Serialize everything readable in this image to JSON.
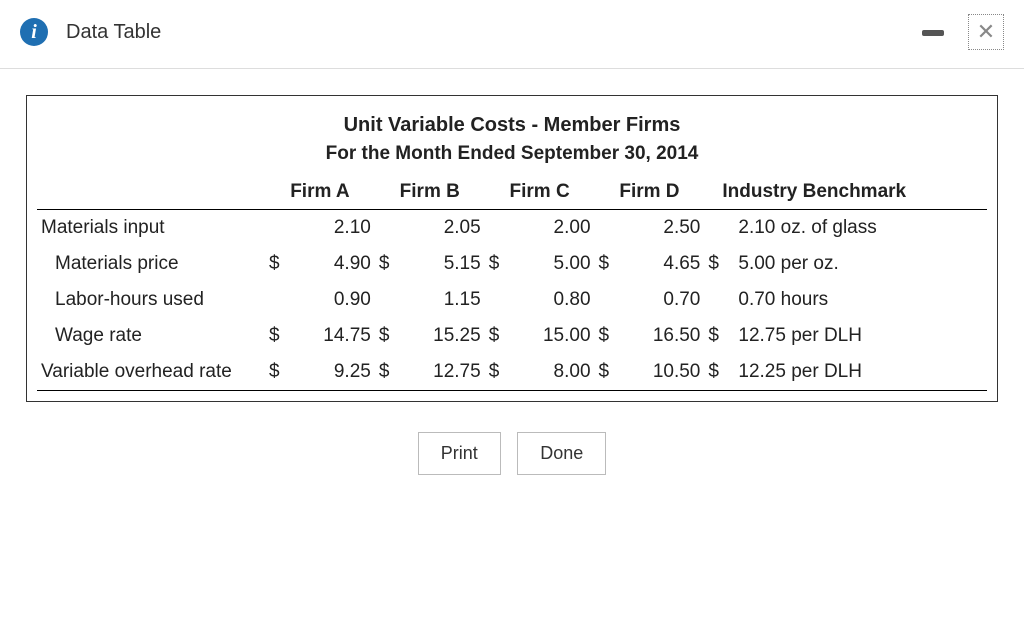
{
  "header": {
    "title": "Data Table",
    "info_glyph": "i",
    "close_glyph": "✕"
  },
  "buttons": {
    "print": "Print",
    "done": "Done"
  },
  "chart_data": {
    "type": "table",
    "title": "Unit Variable Costs - Member Firms",
    "subtitle": "For the Month Ended September 30, 2014",
    "columns": [
      "Firm A",
      "Firm B",
      "Firm C",
      "Firm D",
      "Industry Benchmark"
    ],
    "rows": [
      {
        "label": "Materials input",
        "indent": false,
        "currency": false,
        "values": [
          "2.10",
          "2.05",
          "2.00",
          "2.50"
        ],
        "benchmark": "2.10 oz. of glass"
      },
      {
        "label": "Materials price",
        "indent": true,
        "currency": true,
        "values": [
          "4.90",
          "5.15",
          "5.00",
          "4.65"
        ],
        "benchmark": "5.00 per oz.",
        "benchmark_currency": true
      },
      {
        "label": "Labor-hours used",
        "indent": true,
        "currency": false,
        "values": [
          "0.90",
          "1.15",
          "0.80",
          "0.70"
        ],
        "benchmark": "0.70 hours"
      },
      {
        "label": "Wage rate",
        "indent": true,
        "currency": true,
        "values": [
          "14.75",
          "15.25",
          "15.00",
          "16.50"
        ],
        "benchmark": "12.75 per DLH",
        "benchmark_currency": true
      },
      {
        "label": "Variable overhead rate",
        "indent": false,
        "currency": true,
        "values": [
          "9.25",
          "12.75",
          "8.00",
          "10.50"
        ],
        "benchmark": "12.25 per DLH",
        "benchmark_currency": true
      }
    ]
  }
}
